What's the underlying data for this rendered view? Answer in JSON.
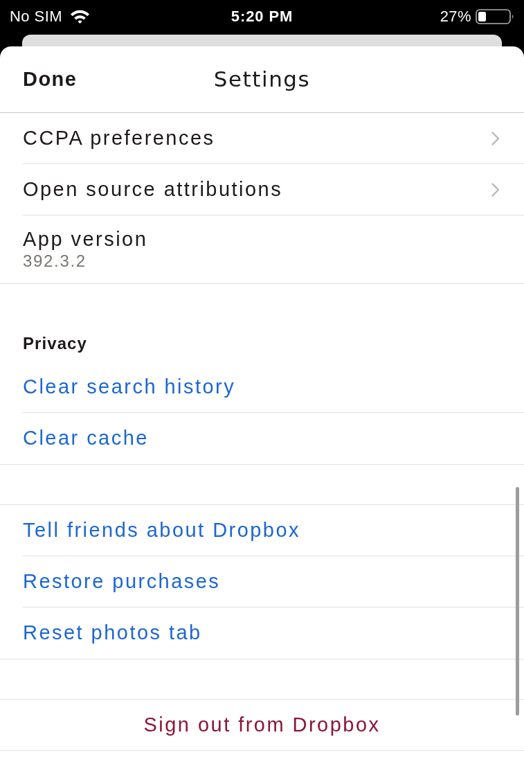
{
  "status_bar": {
    "carrier": "No SIM",
    "time": "5:20 PM",
    "battery": "27%"
  },
  "header": {
    "done": "Done",
    "title": "Settings"
  },
  "sections": [
    {
      "items": [
        {
          "kind": "nav",
          "label": "CCPA preferences"
        },
        {
          "kind": "nav",
          "label": "Open source attributions"
        },
        {
          "kind": "info",
          "label": "App version",
          "value": "392.3.2"
        }
      ]
    },
    {
      "title": "Privacy",
      "items": [
        {
          "kind": "action",
          "label": "Clear search history"
        },
        {
          "kind": "action",
          "label": "Clear cache"
        }
      ]
    },
    {
      "items": [
        {
          "kind": "action",
          "label": "Tell friends about Dropbox"
        },
        {
          "kind": "action",
          "label": "Restore purchases"
        },
        {
          "kind": "action",
          "label": "Reset photos tab"
        }
      ]
    },
    {
      "items": [
        {
          "kind": "destructive",
          "label": "Sign out from Dropbox"
        }
      ]
    }
  ]
}
